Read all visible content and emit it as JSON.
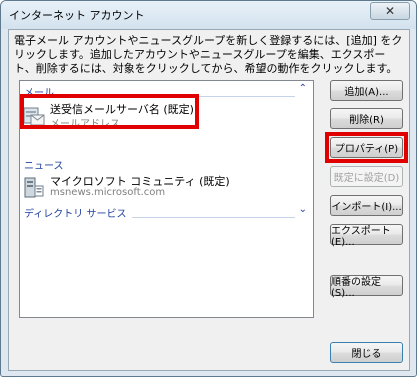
{
  "window": {
    "title": "インターネット アカウント",
    "close_glyph": "✕"
  },
  "description": "電子メール アカウントやニュースグループを新しく登録するには、[追加] をクリックします。追加したアカウントやニュースグループを編集、エクスポート、削除するには、対象をクリックしてから、希望の動作をクリックします。",
  "list": {
    "groups": [
      {
        "header": "メール",
        "chevron": "⌃",
        "items": [
          {
            "name": "送受信メールサーバ名 (既定)",
            "sub": "メールアドレス",
            "icon": "mail-account-icon"
          }
        ]
      },
      {
        "header": "ニュース",
        "items": [
          {
            "name": "マイクロソフト コミュニティ (既定)",
            "sub": "msnews.microsoft.com",
            "icon": "news-server-icon"
          }
        ]
      },
      {
        "header": "ディレクトリ サービス",
        "chevron": "⌄",
        "items": []
      }
    ]
  },
  "buttons": {
    "add": "追加(A)...",
    "remove": "削除(R)",
    "properties": "プロパティ(P)",
    "set_default": "既定に設定(D)",
    "import": "インポート(I)...",
    "export": "エクスポート(E)...",
    "order": "順番の設定(S)...",
    "close": "閉じる"
  },
  "highlight_color": "#e00000"
}
